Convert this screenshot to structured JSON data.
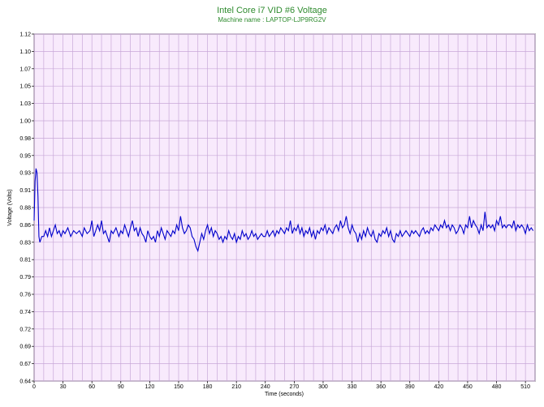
{
  "chart_data": {
    "type": "line",
    "title": "Intel Core i7 VID #6 Voltage",
    "subtitle": "Machine name : LAPTOP-LJP9RG2V",
    "xlabel": "Time (seconds)",
    "ylabel": "Voltage (Volts)",
    "xlim": [
      0,
      520
    ],
    "ylim": [
      0.64,
      1.12
    ],
    "x_ticks": [
      0,
      30,
      60,
      90,
      120,
      150,
      180,
      210,
      240,
      270,
      300,
      330,
      360,
      390,
      420,
      450,
      480,
      510
    ],
    "y_ticks": [
      "0.64",
      "0.67",
      "0.69",
      "0.72",
      "0.74",
      "0.76",
      "0.79",
      "0.81",
      "0.83",
      "0.86",
      "0.88",
      "0.91",
      "0.93",
      "0.95",
      "0.98",
      "1.00",
      "1.03",
      "1.05",
      "1.07",
      "1.10",
      "1.12"
    ],
    "grid": true,
    "series": [
      {
        "values": [
          [
            0,
            0.865
          ],
          [
            1,
            0.92
          ],
          [
            2,
            0.935
          ],
          [
            3,
            0.93
          ],
          [
            4,
            0.9
          ],
          [
            5,
            0.84
          ],
          [
            6,
            0.83
          ],
          [
            8,
            0.84
          ],
          [
            10,
            0.84
          ],
          [
            12,
            0.85
          ],
          [
            14,
            0.84
          ],
          [
            16,
            0.855
          ],
          [
            18,
            0.84
          ],
          [
            20,
            0.85
          ],
          [
            22,
            0.86
          ],
          [
            24,
            0.845
          ],
          [
            26,
            0.85
          ],
          [
            28,
            0.84
          ],
          [
            30,
            0.85
          ],
          [
            32,
            0.845
          ],
          [
            35,
            0.855
          ],
          [
            38,
            0.84
          ],
          [
            41,
            0.85
          ],
          [
            44,
            0.845
          ],
          [
            47,
            0.85
          ],
          [
            50,
            0.84
          ],
          [
            52,
            0.855
          ],
          [
            55,
            0.845
          ],
          [
            58,
            0.85
          ],
          [
            60,
            0.865
          ],
          [
            62,
            0.84
          ],
          [
            64,
            0.85
          ],
          [
            66,
            0.86
          ],
          [
            68,
            0.85
          ],
          [
            70,
            0.865
          ],
          [
            72,
            0.845
          ],
          [
            74,
            0.85
          ],
          [
            76,
            0.84
          ],
          [
            78,
            0.83
          ],
          [
            80,
            0.85
          ],
          [
            82,
            0.845
          ],
          [
            85,
            0.855
          ],
          [
            88,
            0.84
          ],
          [
            90,
            0.85
          ],
          [
            92,
            0.845
          ],
          [
            94,
            0.86
          ],
          [
            96,
            0.85
          ],
          [
            98,
            0.84
          ],
          [
            100,
            0.855
          ],
          [
            102,
            0.865
          ],
          [
            104,
            0.85
          ],
          [
            106,
            0.855
          ],
          [
            108,
            0.84
          ],
          [
            110,
            0.855
          ],
          [
            112,
            0.845
          ],
          [
            114,
            0.84
          ],
          [
            116,
            0.83
          ],
          [
            118,
            0.85
          ],
          [
            120,
            0.84
          ],
          [
            122,
            0.835
          ],
          [
            124,
            0.84
          ],
          [
            126,
            0.83
          ],
          [
            128,
            0.85
          ],
          [
            130,
            0.84
          ],
          [
            132,
            0.855
          ],
          [
            134,
            0.845
          ],
          [
            136,
            0.835
          ],
          [
            138,
            0.85
          ],
          [
            140,
            0.845
          ],
          [
            142,
            0.84
          ],
          [
            144,
            0.85
          ],
          [
            146,
            0.845
          ],
          [
            148,
            0.86
          ],
          [
            150,
            0.85
          ],
          [
            152,
            0.87
          ],
          [
            154,
            0.855
          ],
          [
            156,
            0.845
          ],
          [
            158,
            0.85
          ],
          [
            160,
            0.86
          ],
          [
            162,
            0.855
          ],
          [
            164,
            0.84
          ],
          [
            166,
            0.835
          ],
          [
            168,
            0.825
          ],
          [
            170,
            0.82
          ],
          [
            172,
            0.83
          ],
          [
            174,
            0.845
          ],
          [
            176,
            0.835
          ],
          [
            178,
            0.85
          ],
          [
            180,
            0.86
          ],
          [
            182,
            0.845
          ],
          [
            184,
            0.855
          ],
          [
            186,
            0.84
          ],
          [
            188,
            0.85
          ],
          [
            190,
            0.845
          ],
          [
            192,
            0.835
          ],
          [
            194,
            0.84
          ],
          [
            196,
            0.83
          ],
          [
            198,
            0.84
          ],
          [
            200,
            0.835
          ],
          [
            202,
            0.85
          ],
          [
            204,
            0.84
          ],
          [
            206,
            0.835
          ],
          [
            208,
            0.845
          ],
          [
            210,
            0.83
          ],
          [
            212,
            0.84
          ],
          [
            214,
            0.835
          ],
          [
            216,
            0.85
          ],
          [
            218,
            0.84
          ],
          [
            220,
            0.845
          ],
          [
            222,
            0.835
          ],
          [
            224,
            0.84
          ],
          [
            226,
            0.85
          ],
          [
            228,
            0.84
          ],
          [
            230,
            0.845
          ],
          [
            232,
            0.835
          ],
          [
            234,
            0.84
          ],
          [
            236,
            0.845
          ],
          [
            238,
            0.84
          ],
          [
            240,
            0.84
          ],
          [
            242,
            0.85
          ],
          [
            244,
            0.84
          ],
          [
            246,
            0.845
          ],
          [
            248,
            0.85
          ],
          [
            250,
            0.84
          ],
          [
            252,
            0.85
          ],
          [
            254,
            0.845
          ],
          [
            256,
            0.855
          ],
          [
            258,
            0.85
          ],
          [
            260,
            0.845
          ],
          [
            262,
            0.855
          ],
          [
            264,
            0.85
          ],
          [
            266,
            0.865
          ],
          [
            268,
            0.845
          ],
          [
            270,
            0.855
          ],
          [
            272,
            0.85
          ],
          [
            274,
            0.86
          ],
          [
            276,
            0.845
          ],
          [
            278,
            0.855
          ],
          [
            280,
            0.84
          ],
          [
            282,
            0.85
          ],
          [
            284,
            0.845
          ],
          [
            286,
            0.855
          ],
          [
            288,
            0.84
          ],
          [
            290,
            0.85
          ],
          [
            292,
            0.835
          ],
          [
            294,
            0.85
          ],
          [
            296,
            0.845
          ],
          [
            298,
            0.855
          ],
          [
            300,
            0.85
          ],
          [
            302,
            0.86
          ],
          [
            304,
            0.845
          ],
          [
            306,
            0.855
          ],
          [
            308,
            0.85
          ],
          [
            310,
            0.845
          ],
          [
            312,
            0.855
          ],
          [
            314,
            0.86
          ],
          [
            316,
            0.85
          ],
          [
            318,
            0.865
          ],
          [
            320,
            0.855
          ],
          [
            322,
            0.86
          ],
          [
            324,
            0.87
          ],
          [
            326,
            0.855
          ],
          [
            328,
            0.845
          ],
          [
            330,
            0.86
          ],
          [
            332,
            0.85
          ],
          [
            334,
            0.845
          ],
          [
            336,
            0.83
          ],
          [
            338,
            0.845
          ],
          [
            340,
            0.835
          ],
          [
            342,
            0.85
          ],
          [
            344,
            0.84
          ],
          [
            346,
            0.855
          ],
          [
            348,
            0.845
          ],
          [
            350,
            0.84
          ],
          [
            352,
            0.85
          ],
          [
            354,
            0.835
          ],
          [
            356,
            0.83
          ],
          [
            358,
            0.845
          ],
          [
            360,
            0.84
          ],
          [
            362,
            0.85
          ],
          [
            364,
            0.845
          ],
          [
            366,
            0.855
          ],
          [
            368,
            0.84
          ],
          [
            370,
            0.85
          ],
          [
            372,
            0.835
          ],
          [
            374,
            0.83
          ],
          [
            376,
            0.845
          ],
          [
            378,
            0.84
          ],
          [
            380,
            0.85
          ],
          [
            382,
            0.84
          ],
          [
            384,
            0.845
          ],
          [
            386,
            0.85
          ],
          [
            388,
            0.845
          ],
          [
            390,
            0.84
          ],
          [
            392,
            0.85
          ],
          [
            394,
            0.845
          ],
          [
            396,
            0.85
          ],
          [
            398,
            0.845
          ],
          [
            400,
            0.84
          ],
          [
            402,
            0.85
          ],
          [
            404,
            0.855
          ],
          [
            406,
            0.845
          ],
          [
            408,
            0.85
          ],
          [
            410,
            0.845
          ],
          [
            412,
            0.855
          ],
          [
            414,
            0.85
          ],
          [
            416,
            0.86
          ],
          [
            418,
            0.855
          ],
          [
            420,
            0.85
          ],
          [
            422,
            0.86
          ],
          [
            424,
            0.855
          ],
          [
            426,
            0.865
          ],
          [
            428,
            0.855
          ],
          [
            430,
            0.86
          ],
          [
            432,
            0.85
          ],
          [
            434,
            0.86
          ],
          [
            436,
            0.855
          ],
          [
            438,
            0.845
          ],
          [
            440,
            0.85
          ],
          [
            442,
            0.86
          ],
          [
            444,
            0.855
          ],
          [
            446,
            0.845
          ],
          [
            448,
            0.86
          ],
          [
            450,
            0.855
          ],
          [
            452,
            0.87
          ],
          [
            454,
            0.855
          ],
          [
            456,
            0.865
          ],
          [
            458,
            0.86
          ],
          [
            460,
            0.855
          ],
          [
            462,
            0.845
          ],
          [
            464,
            0.86
          ],
          [
            466,
            0.85
          ],
          [
            468,
            0.875
          ],
          [
            470,
            0.855
          ],
          [
            472,
            0.86
          ],
          [
            474,
            0.855
          ],
          [
            476,
            0.86
          ],
          [
            478,
            0.85
          ],
          [
            480,
            0.865
          ],
          [
            482,
            0.86
          ],
          [
            484,
            0.87
          ],
          [
            486,
            0.855
          ],
          [
            488,
            0.86
          ],
          [
            490,
            0.855
          ],
          [
            492,
            0.86
          ],
          [
            494,
            0.86
          ],
          [
            496,
            0.855
          ],
          [
            498,
            0.865
          ],
          [
            500,
            0.85
          ],
          [
            502,
            0.86
          ],
          [
            504,
            0.855
          ],
          [
            506,
            0.86
          ],
          [
            508,
            0.855
          ],
          [
            510,
            0.845
          ],
          [
            512,
            0.86
          ],
          [
            514,
            0.85
          ],
          [
            516,
            0.855
          ],
          [
            518,
            0.85
          ]
        ],
        "color": "#0000cc"
      }
    ],
    "colors": {
      "plot_background": "#f8eafc",
      "grid": "#c8a8d8",
      "title": "#2e8b2e",
      "line": "#0000cc"
    }
  }
}
